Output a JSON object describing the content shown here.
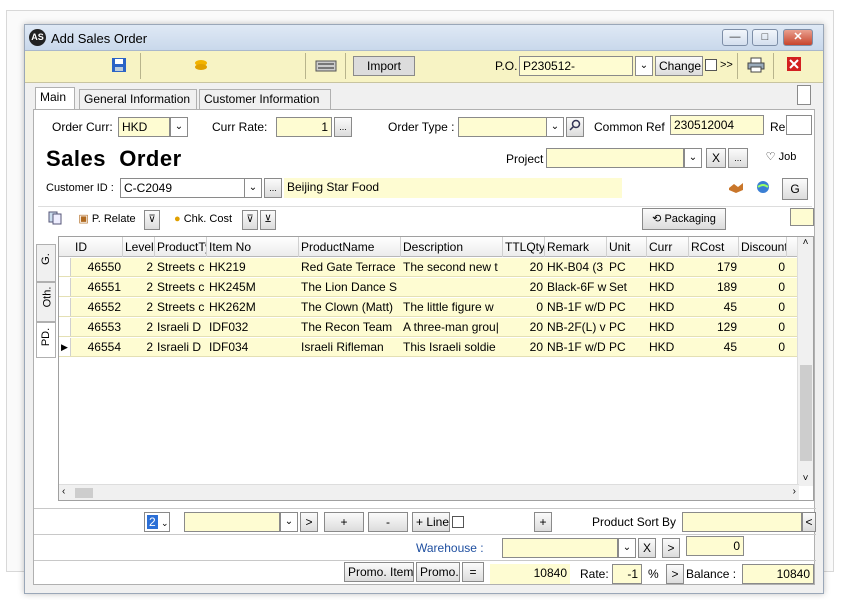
{
  "window": {
    "title": "Add Sales Order",
    "minimize": "—",
    "maximize": "□",
    "close": "✕"
  },
  "toolbar": {
    "import_label": "Import",
    "po_label": "P.O.",
    "po_value": "P230512-",
    "change_label": "Change",
    "more_label": ">>",
    "save_icon": "save-icon",
    "coins_icon": "coins-icon",
    "keyboard_icon": "keyboard-icon",
    "print_icon": "printer-icon",
    "delete_icon": "delete-icon"
  },
  "tabs": [
    "Main",
    "General Information",
    "Customer Information"
  ],
  "header": {
    "order_curr_label": "Order Curr:",
    "order_curr_value": "HKD",
    "curr_rate_label": "Curr Rate:",
    "curr_rate_value": "1",
    "ellipsis": "...",
    "order_type_label": "Order Type :",
    "order_type_value": "",
    "common_ref_label": "Common Ref",
    "common_ref_value": "230512004",
    "re_label": "Re",
    "title": "Sales  Order",
    "project_label": "Project",
    "project_value": "",
    "x_label": "X",
    "job_label": "Job",
    "customer_id_label": "Customer ID :",
    "customer_id_value": "C-C2049",
    "customer_name": "Beijing Star Food",
    "g_label": "G"
  },
  "subtoolbar": {
    "p_relate_label": "P. Relate",
    "chk_cost_label": "Chk. Cost",
    "packaging_label": "Packaging"
  },
  "side_tabs": [
    "G.",
    "Oth.",
    "PD."
  ],
  "grid": {
    "columns": [
      "ID",
      "Level",
      "ProductTy",
      "Item No",
      "ProductName",
      "Description",
      "TTLQty",
      "Remark",
      "Unit",
      "Curr",
      "RCost",
      "Discount"
    ],
    "rows": [
      [
        "46550",
        "2",
        "Streets c",
        "HK219",
        "Red Gate Terrace",
        "The second new t",
        "20",
        "HK-B04 (3",
        "PC",
        "HKD",
        "179",
        "0"
      ],
      [
        "46551",
        "2",
        "Streets c",
        "HK245M",
        "The Lion Dance S",
        "",
        "20",
        "Black-6F w",
        "Set",
        "HKD",
        "189",
        "0"
      ],
      [
        "46552",
        "2",
        "Streets c",
        "HK262M",
        "The Clown (Matt)",
        "The little figure w",
        "0",
        "NB-1F w/D",
        "PC",
        "HKD",
        "45",
        "0"
      ],
      [
        "46553",
        "2",
        "Israeli D",
        "IDF032",
        "The Recon Team",
        "A three-man grou|",
        "20",
        "NB-2F(L) v",
        "PC",
        "HKD",
        "129",
        "0"
      ],
      [
        "46554",
        "2",
        "Israeli D",
        "IDF034",
        "Israeli Rifleman",
        "This Israeli soldie",
        "20",
        "NB-1F w/D",
        "PC",
        "HKD",
        "45",
        "0"
      ]
    ],
    "current_row_marker": "▶"
  },
  "bottom": {
    "level_value": "2",
    "nav_next": ">",
    "plus": "+",
    "minus": "-",
    "plus_line_label": "+ Line",
    "plus2": "+",
    "product_sort_label": "Product Sort By",
    "product_sort_value": "",
    "lt": "<",
    "warehouse_label": "Warehouse :",
    "warehouse_value": "",
    "x_label": "X",
    "gt": ">",
    "wh_qty": "0",
    "promo_item_label": "Promo. Item",
    "promo_label": "Promo.",
    "eq_label": "=",
    "total_value": "10840",
    "rate_label": "Rate:",
    "rate_value": "-1",
    "percent": "%",
    "arrow": ">",
    "balance_label": "Balance :",
    "balance_value": "10840"
  },
  "colors": {
    "toolbar_bg": "#f7f3c4",
    "field_bg": "#fefcd2",
    "warehouse_label": "#1f4fa0"
  }
}
